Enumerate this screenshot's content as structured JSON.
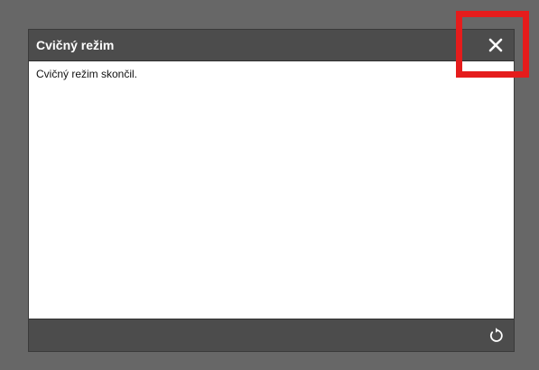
{
  "dialog": {
    "title": "Cvičný režim",
    "message": "Cvičný režim skončil."
  },
  "icons": {
    "close": "close-icon",
    "restart": "restart-icon"
  },
  "colors": {
    "backdrop": "#676767",
    "titlebar": "#4c4c4c",
    "highlight": "#e51c1c"
  }
}
